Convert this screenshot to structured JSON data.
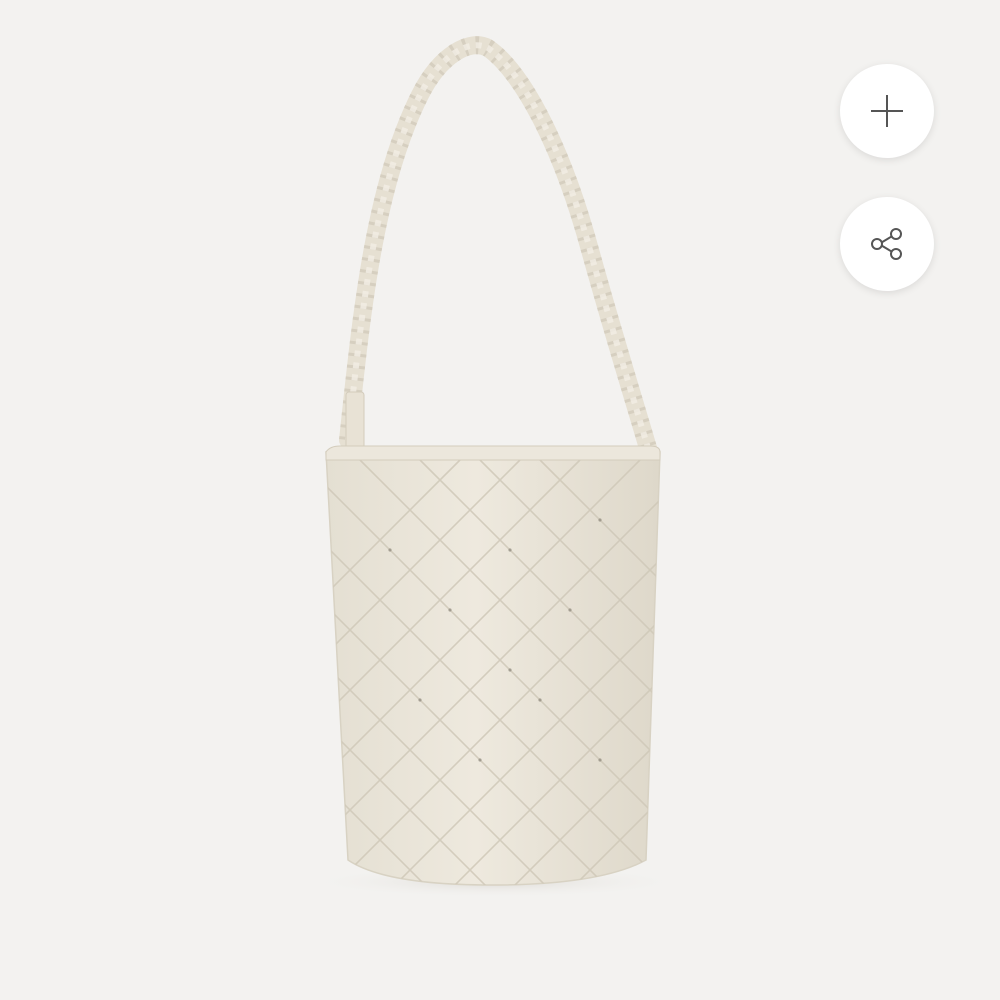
{
  "product": {
    "image_alt": "",
    "colors": {
      "background": "#f3f2f0",
      "bag_body": "#ebe6da",
      "bag_shadow": "#d8d2c3",
      "bag_line": "#cfc8b8",
      "icon_stroke": "#555555",
      "button_bg": "#ffffff"
    }
  },
  "actions": {
    "add": {
      "icon": "plus-icon"
    },
    "share": {
      "icon": "share-icon"
    }
  }
}
